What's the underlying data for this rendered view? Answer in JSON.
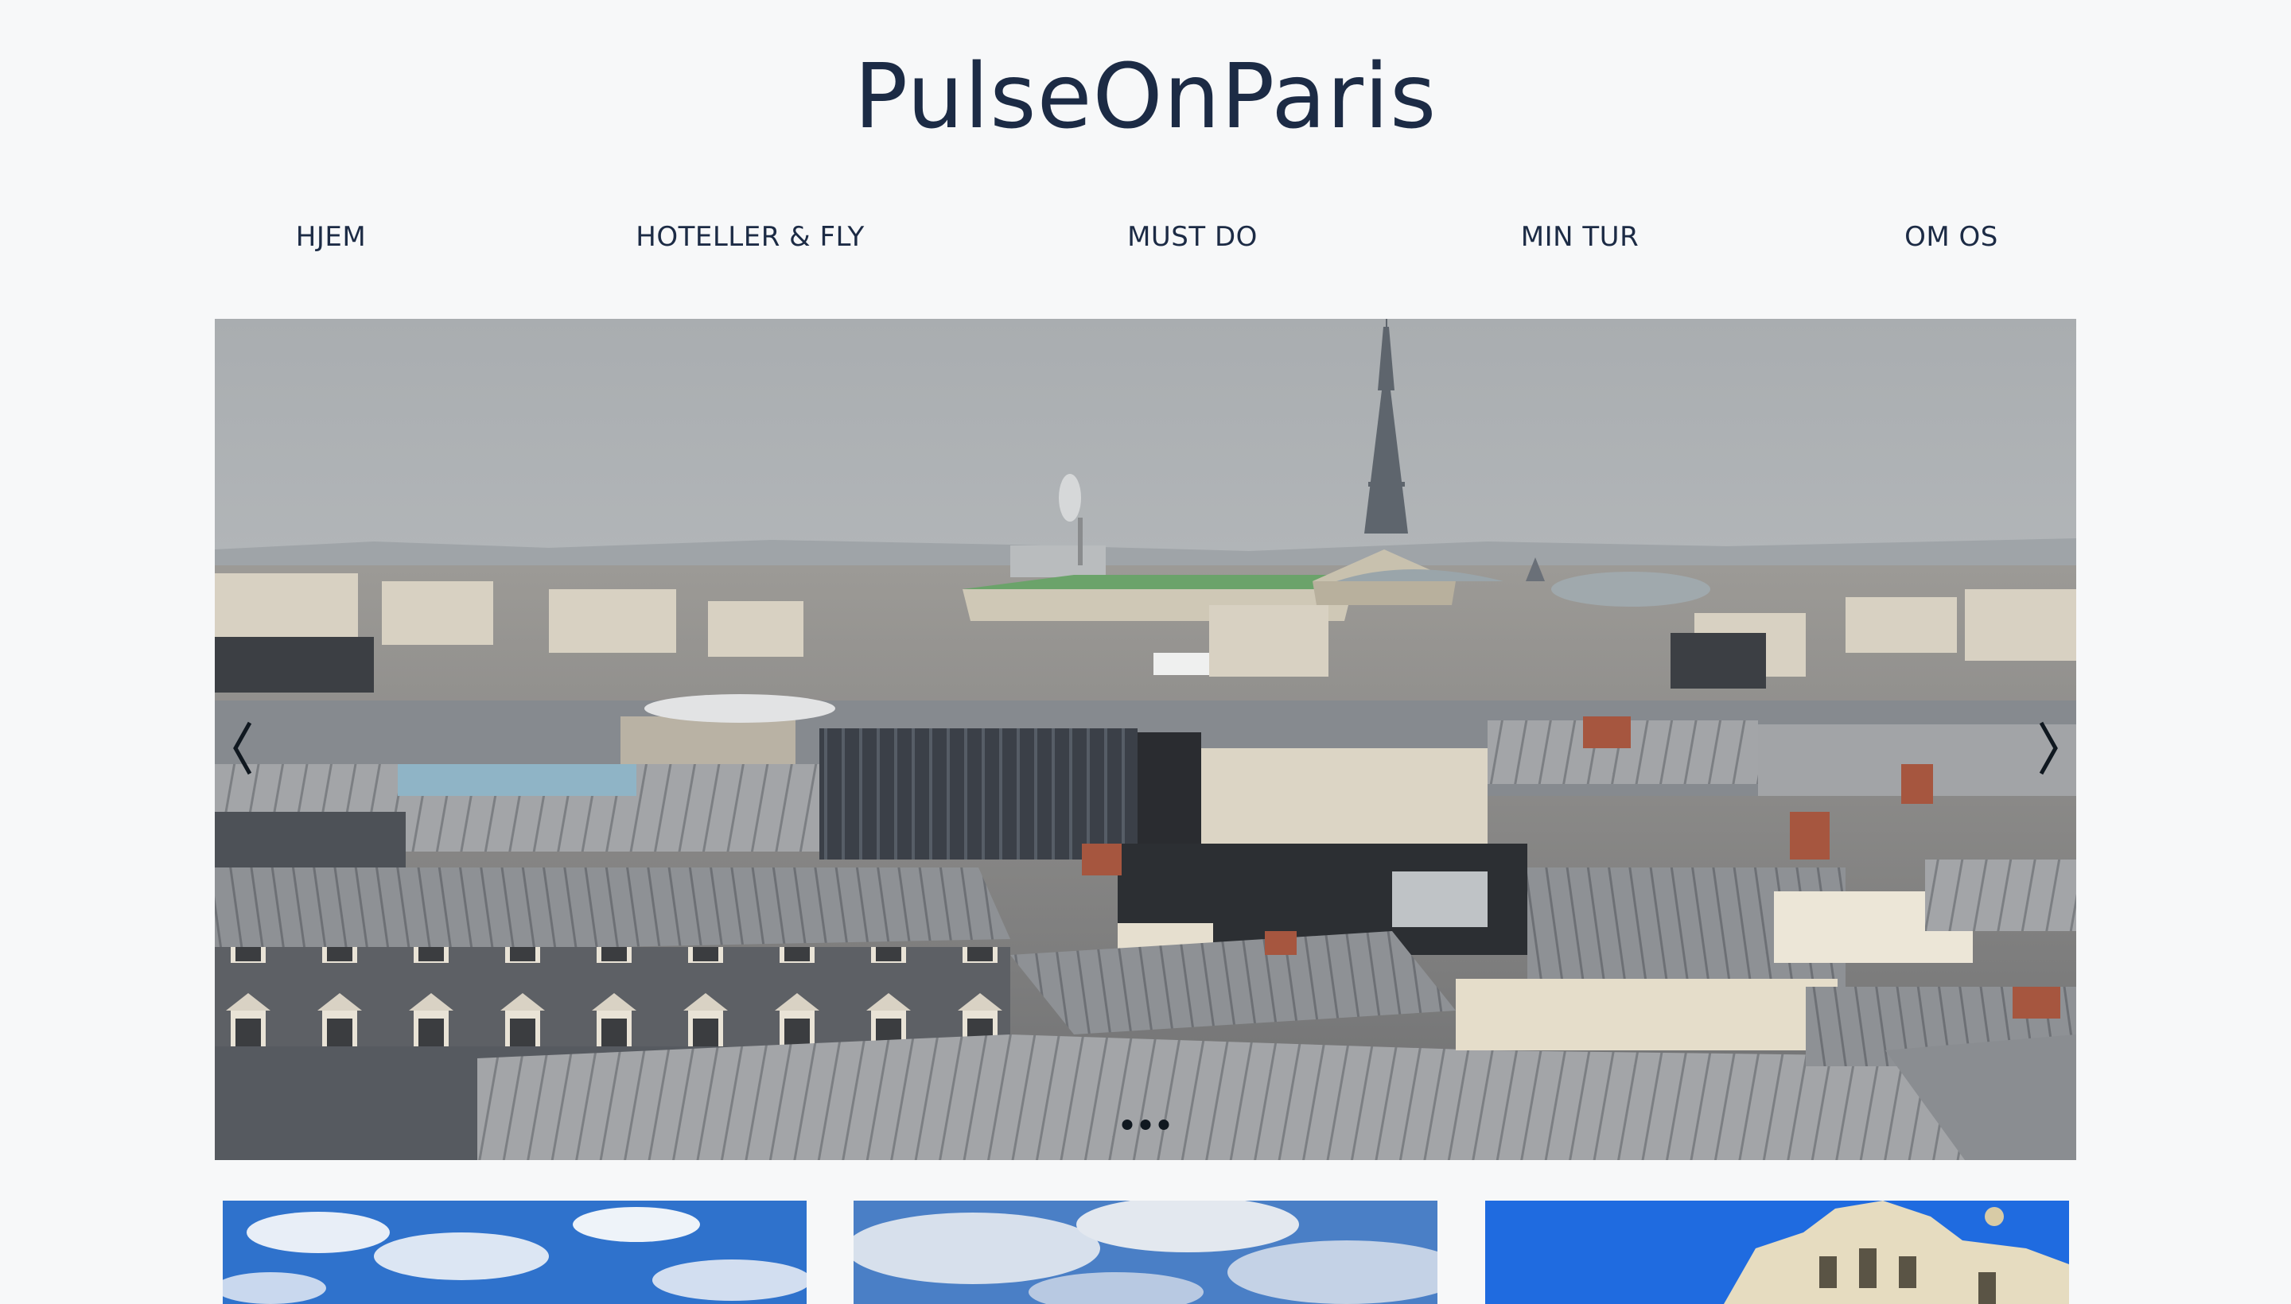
{
  "site": {
    "title": "PulseOnParis"
  },
  "nav": {
    "items": [
      {
        "label": "HJEM"
      },
      {
        "label": "HOTELLER & FLY"
      },
      {
        "label": "MUST DO"
      },
      {
        "label": "MIN TUR"
      },
      {
        "label": "OM OS"
      }
    ]
  },
  "hero": {
    "image": "paris-rooftops-eiffel-tower-photo",
    "prev_icon": "chevron-left-icon",
    "next_icon": "chevron-right-icon",
    "slide_count": 3
  },
  "thumbnails": [
    {
      "image": "blue-sky-clouds-photo"
    },
    {
      "image": "blue-sky-clouds-photo"
    },
    {
      "image": "blue-sky-ornate-building-photo"
    }
  ],
  "colors": {
    "text": "#1c2b45",
    "background": "#f7f8f9"
  }
}
